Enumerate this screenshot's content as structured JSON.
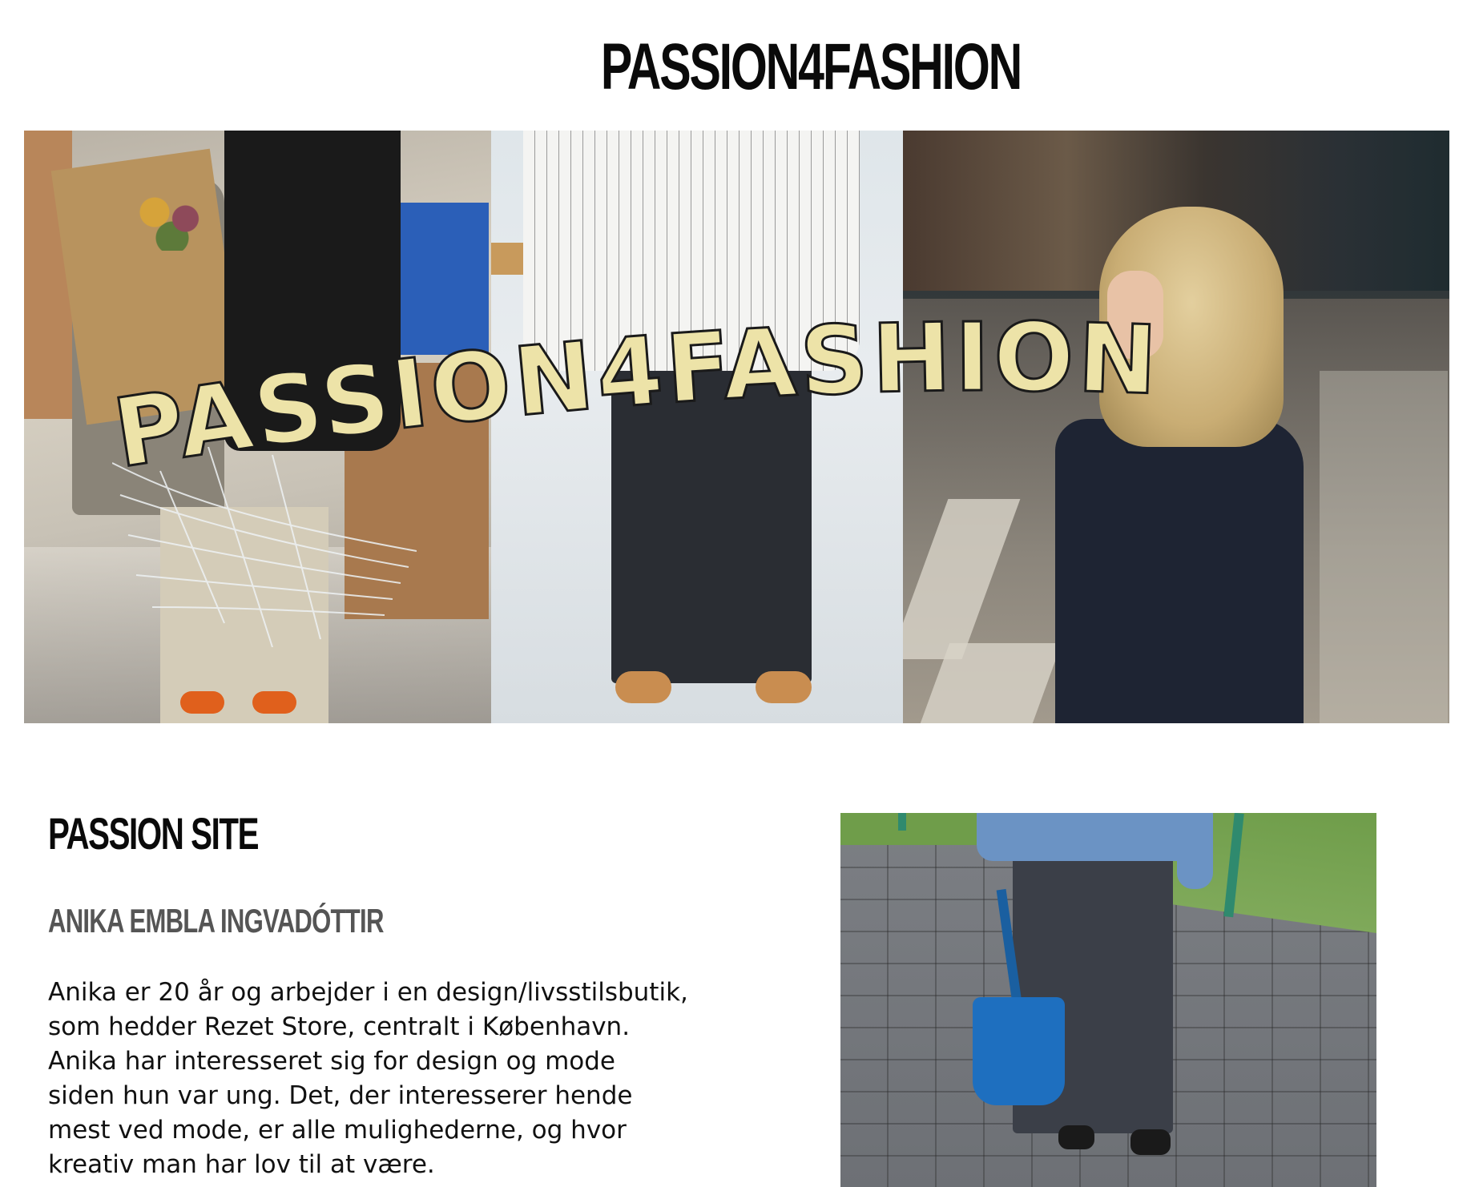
{
  "site": {
    "title": "PASSION4FASHION"
  },
  "banner": {
    "wordmark": "PASSION4FASHION",
    "colors": {
      "wordmark_fill": "#ede3a8",
      "wordmark_stroke": "#1a1a1a"
    }
  },
  "content": {
    "section_title": "PASSION SITE",
    "person_name": "ANIKA EMBLA INGVADÓTTIR",
    "bio": "Anika er 20 år og arbejder i en design/livsstilsbutik, som hedder Rezet Store, centralt i København. Anika har interesseret sig for design og mode siden hun var ung. Det, der interesserer hende mest ved mode, er alle mulighederne, og hvor kreativ man har lov til at være."
  }
}
